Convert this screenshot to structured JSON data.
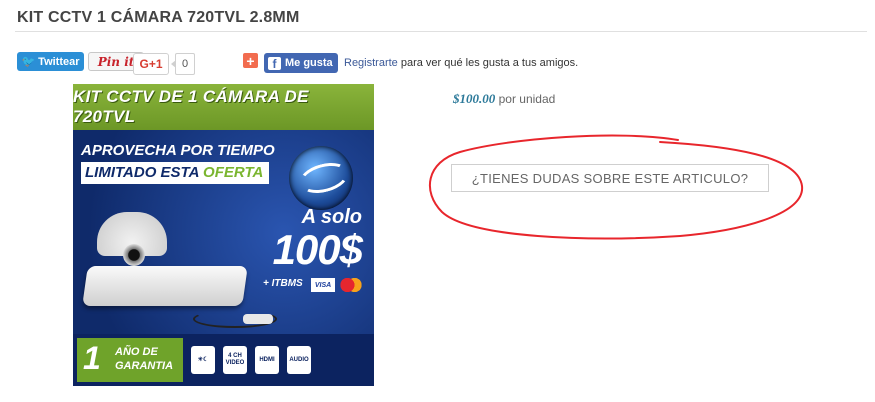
{
  "product": {
    "title": "KIT CCTV 1 CÁMARA 720TVL 2.8MM",
    "price": "$100.00",
    "price_unit": "por unidad",
    "ask_button": "¿TIENES DUDAS SOBRE ESTE ARTICULO?"
  },
  "share": {
    "twitter_label": "Twittear",
    "pinterest_label": "Pin it",
    "gplus_label": "G+1",
    "gplus_count": "0",
    "plus_label": "+",
    "facebook_label": "Me gusta",
    "facebook_register_link": "Registrarte",
    "facebook_register_text": "para ver qué les gusta a tus amigos."
  },
  "promo": {
    "header": "KIT CCTV DE 1 CÁMARA DE 720TVL",
    "offer_line1": "APROVECHA POR TIEMPO",
    "offer_line2": "LIMITADO ESTA ",
    "offer_highlight": "OFERTA",
    "solo": "A solo",
    "price": "100$",
    "tax": "+ ITBMS",
    "card_visa": "VISA",
    "warranty_num": "1",
    "warranty_text": "AÑO DE GARANTIA",
    "feature_4ch": "4 CH VIDEO",
    "feature_hdmi": "HDMI",
    "feature_audio": "AUDIO"
  },
  "colors": {
    "twitter": "#2b8fd6",
    "facebook": "#4267b2",
    "price": "#2d7a9a",
    "annotation": "#e8262c",
    "promo_green": "#7ab52f",
    "promo_blue": "#173a8a"
  }
}
